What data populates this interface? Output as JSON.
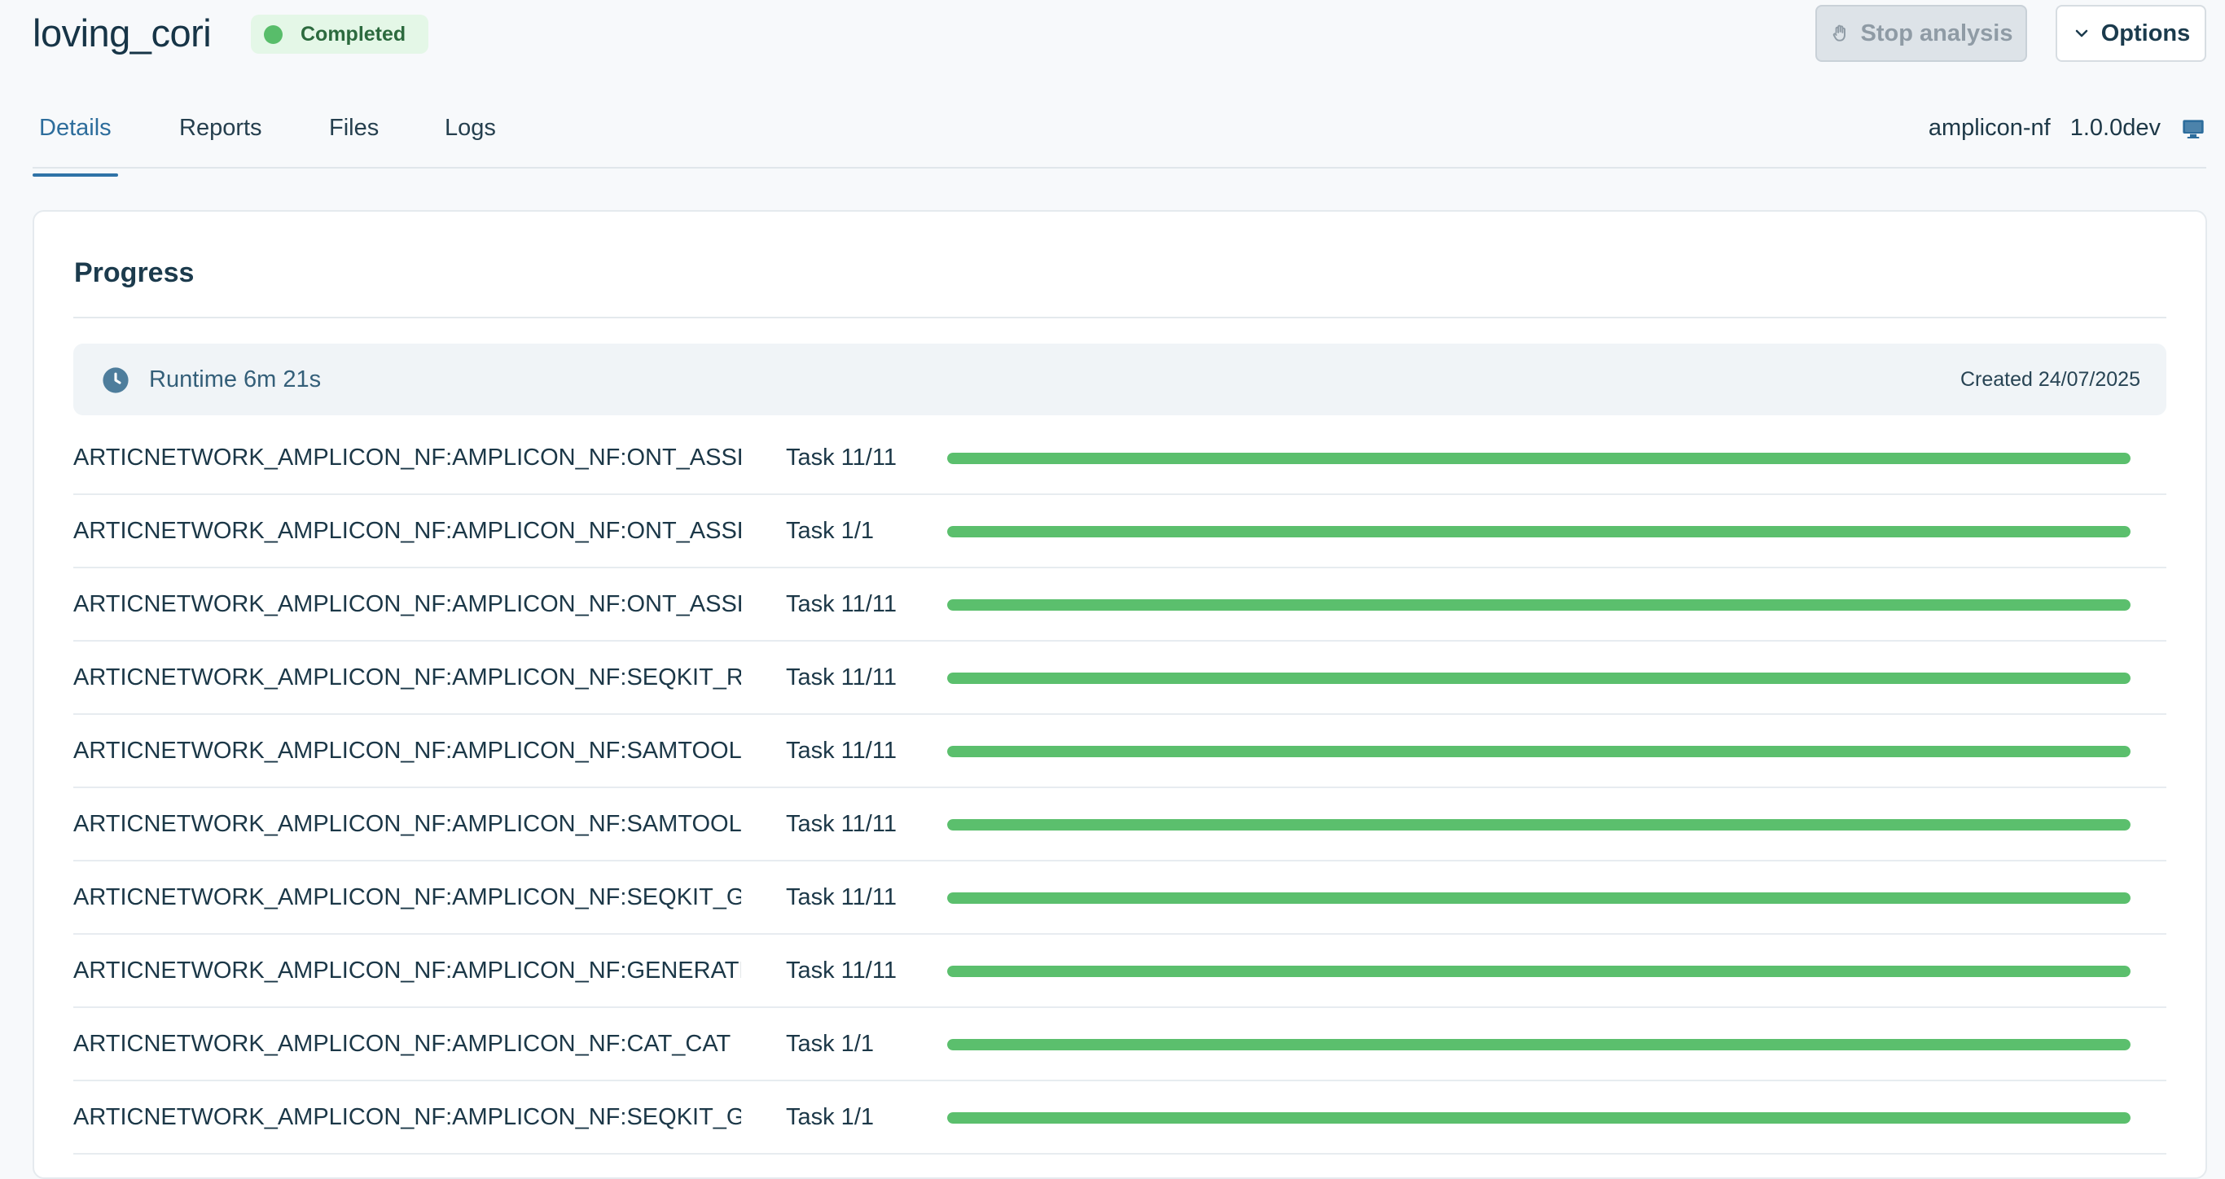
{
  "header": {
    "title": "loving_cori",
    "status": "Completed",
    "stop_button": "Stop analysis",
    "options_button": "Options"
  },
  "tabs": [
    {
      "label": "Details",
      "active": true
    },
    {
      "label": "Reports",
      "active": false
    },
    {
      "label": "Files",
      "active": false
    },
    {
      "label": "Logs",
      "active": false
    }
  ],
  "pipeline": {
    "name": "amplicon-nf",
    "version": "1.0.0dev",
    "icon": "monitor-icon"
  },
  "progress": {
    "title": "Progress",
    "runtime": "Runtime 6m 21s",
    "created": "Created 24/07/2025",
    "tasks": [
      {
        "name": "ARTICNETWORK_AMPLICON_NF:AMPLICON_NF:ONT_ASSE...",
        "count": "Task 11/11",
        "progress": 1.0
      },
      {
        "name": "ARTICNETWORK_AMPLICON_NF:AMPLICON_NF:ONT_ASSE...",
        "count": "Task 1/1",
        "progress": 1.0
      },
      {
        "name": "ARTICNETWORK_AMPLICON_NF:AMPLICON_NF:ONT_ASSE...",
        "count": "Task 11/11",
        "progress": 1.0
      },
      {
        "name": "ARTICNETWORK_AMPLICON_NF:AMPLICON_NF:SEQKIT_RE...",
        "count": "Task 11/11",
        "progress": 1.0
      },
      {
        "name": "ARTICNETWORK_AMPLICON_NF:AMPLICON_NF:SAMTOOL...",
        "count": "Task 11/11",
        "progress": 1.0
      },
      {
        "name": "ARTICNETWORK_AMPLICON_NF:AMPLICON_NF:SAMTOOL...",
        "count": "Task 11/11",
        "progress": 1.0
      },
      {
        "name": "ARTICNETWORK_AMPLICON_NF:AMPLICON_NF:SEQKIT_GR...",
        "count": "Task 11/11",
        "progress": 1.0
      },
      {
        "name": "ARTICNETWORK_AMPLICON_NF:AMPLICON_NF:GENERATE...",
        "count": "Task 11/11",
        "progress": 1.0
      },
      {
        "name": "ARTICNETWORK_AMPLICON_NF:AMPLICON_NF:CAT_CAT",
        "count": "Task 1/1",
        "progress": 1.0
      },
      {
        "name": "ARTICNETWORK_AMPLICON_NF:AMPLICON_NF:SEQKIT_GR...",
        "count": "Task 1/1",
        "progress": 1.0
      }
    ]
  },
  "colors": {
    "status_green": "#58bd6a",
    "progress_green": "#5bbf6d",
    "active_tab_blue": "#2f73a7"
  }
}
